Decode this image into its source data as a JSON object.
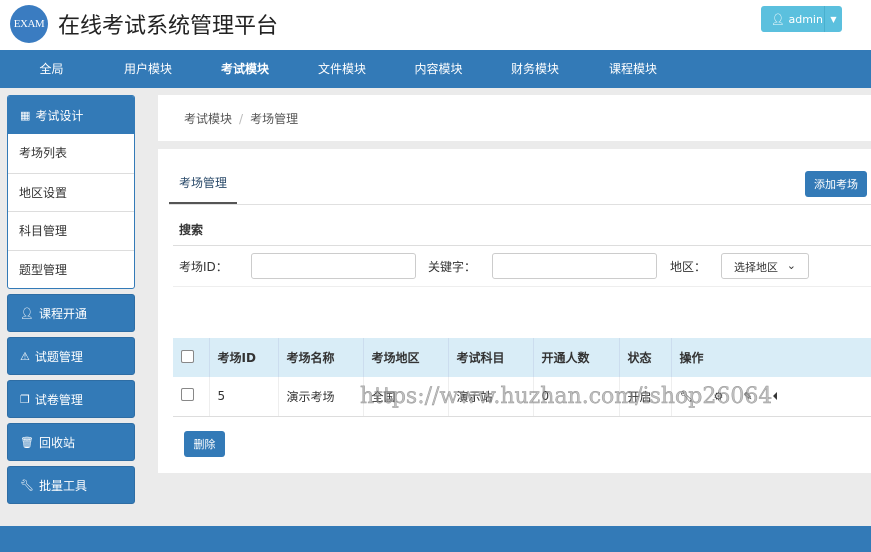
{
  "header": {
    "logo": "EXAM",
    "title": "在线考试系统管理平台",
    "user": "admin",
    "user_icon": "user-icon"
  },
  "nav": [
    "全局",
    "用户模块",
    "考试模块",
    "文件模块",
    "内容模块",
    "财务模块",
    "课程模块"
  ],
  "sidebar": {
    "group": {
      "label": "考试设计",
      "icon": "grid-icon",
      "items": [
        "考场列表",
        "地区设置",
        "科目管理",
        "题型管理"
      ]
    },
    "buttons": [
      {
        "label": "课程开通",
        "icon": "user-icon"
      },
      {
        "label": "试题管理",
        "icon": "warning-icon"
      },
      {
        "label": "试卷管理",
        "icon": "copy-icon"
      },
      {
        "label": "回收站",
        "icon": "trash-icon"
      },
      {
        "label": "批量工具",
        "icon": "wrench-icon"
      }
    ]
  },
  "breadcrumb": [
    "考试模块",
    "考场管理"
  ],
  "panel": {
    "tab": "考场管理",
    "add": "添加考场",
    "search_title": "搜索",
    "filters": {
      "id_label": "考场ID：",
      "keyword_label": "关键字：",
      "region_label": "地区：",
      "region_select": "选择地区"
    },
    "columns": [
      "考场ID",
      "考场名称",
      "考场地区",
      "考试科目",
      "开通人数",
      "状态",
      "操作"
    ],
    "rows": [
      {
        "id": "5",
        "name": "演示考场",
        "region": "全国",
        "subject": "演示站",
        "count": "0",
        "status": "开启"
      }
    ],
    "delete": "删除"
  },
  "watermark": "https://www.huzhan.com/ishop26064",
  "colors": {
    "primary": "#337ab7",
    "info": "#5bc0de",
    "table_header": "#d9edf7"
  }
}
